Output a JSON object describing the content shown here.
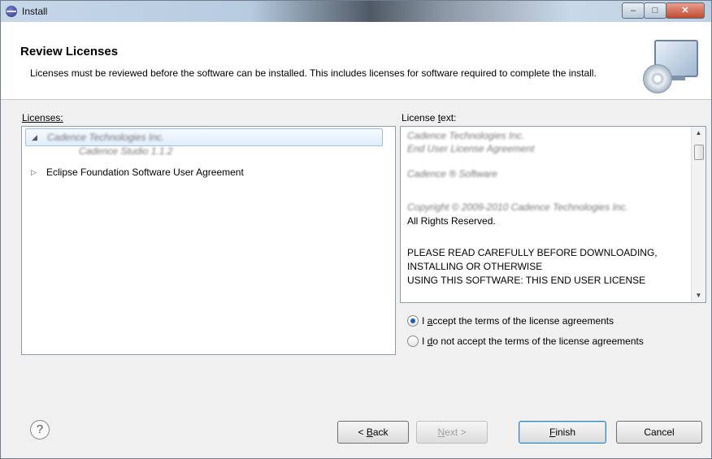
{
  "window": {
    "title": "Install",
    "controls": {
      "minimize": "–",
      "maximize": "□",
      "close": "✕"
    }
  },
  "header": {
    "title": "Review Licenses",
    "description": "Licenses must be reviewed before the software can be installed.  This includes licenses for software required to complete the install.",
    "icon": "monitor-disc-icon"
  },
  "licenses": {
    "label": "Licenses:",
    "items": [
      {
        "label": "Cadence Technologies Inc.",
        "expanded": true,
        "blurred": true,
        "children": [
          "Cadence Studio 1.1.2"
        ]
      },
      {
        "label": "Eclipse Foundation Software User Agreement",
        "expanded": false
      }
    ]
  },
  "license_text": {
    "label": "License text:",
    "blurred_lines": [
      "Cadence Technologies Inc.",
      "End User License Agreement",
      "Cadence ® Software",
      "Copyright © 2009-2010 Cadence Technologies Inc."
    ],
    "lines": [
      "All Rights Reserved.",
      "PLEASE READ CAREFULLY BEFORE DOWNLOADING,",
      "INSTALLING OR OTHERWISE",
      "USING THIS SOFTWARE:  THIS END USER LICENSE"
    ]
  },
  "options": {
    "accept": {
      "prefix": "I ",
      "mnemonic": "a",
      "rest": "ccept the terms of the license agreements",
      "checked": true
    },
    "decline": {
      "prefix": "I ",
      "mnemonic": "d",
      "rest": "o not accept the terms of the license agreements",
      "checked": false
    }
  },
  "footer": {
    "help": "?",
    "back": {
      "prefix": "< ",
      "mnemonic": "B",
      "rest": "ack"
    },
    "next": {
      "prefix": "",
      "mnemonic": "N",
      "rest": "ext >",
      "disabled": true
    },
    "finish": {
      "prefix": "",
      "mnemonic": "F",
      "rest": "inish"
    },
    "cancel": "Cancel"
  }
}
